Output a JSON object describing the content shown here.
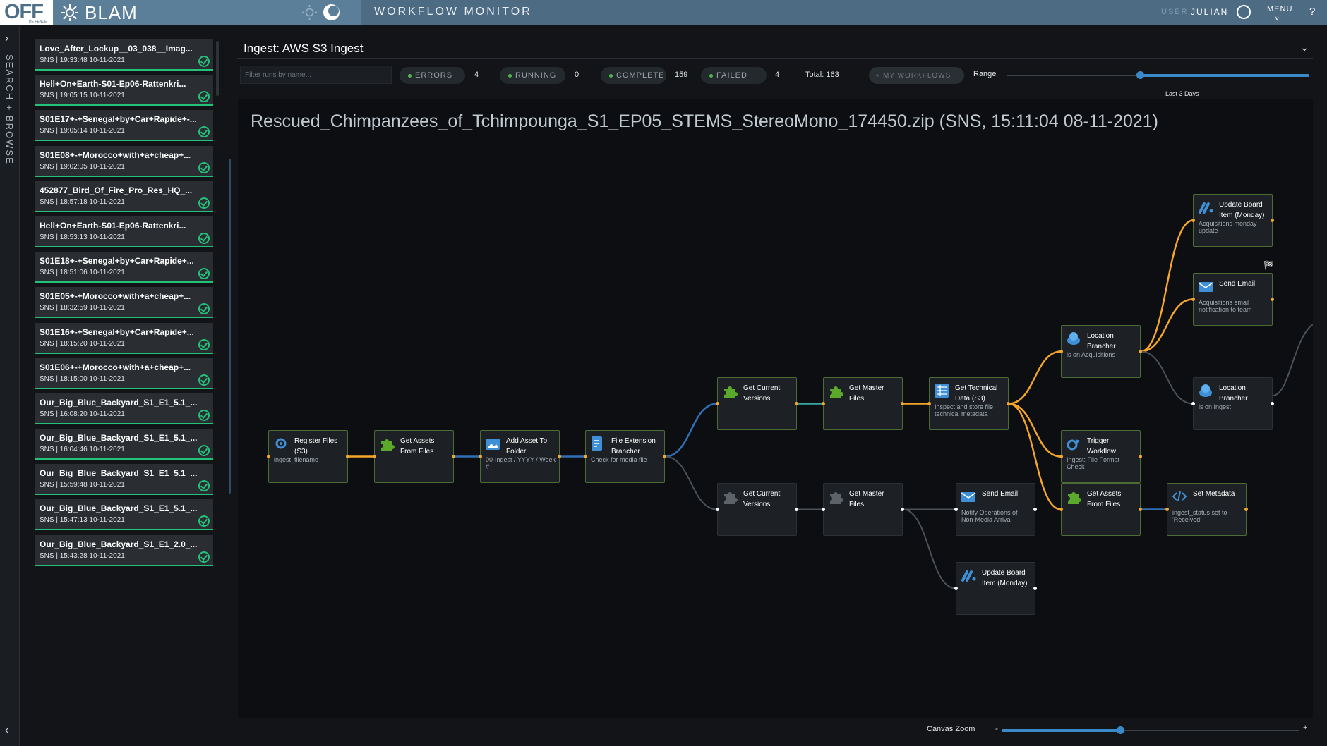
{
  "header": {
    "logo_text": "OFF",
    "logo_subtext": "THE FENCE",
    "brand": "BLAM",
    "app_title": "WORKFLOW MONITOR",
    "user_label": "USER",
    "user_name": "JULIAN",
    "menu_label": "MENU",
    "help_label": "?"
  },
  "sidebar": {
    "vertical_label": "SEARCH + BROWSE"
  },
  "runs": [
    {
      "name": "Love_After_Lockup__03_038__Imag...",
      "meta": "SNS | 19:33:48 10-11-2021",
      "status": "complete"
    },
    {
      "name": "Hell+On+Earth-S01-Ep06-Rattenkri...",
      "meta": "SNS | 19:05:15 10-11-2021",
      "status": "complete"
    },
    {
      "name": "S01E17+-+Senegal+by+Car+Rapide+-...",
      "meta": "SNS | 19:05:14 10-11-2021",
      "status": "complete"
    },
    {
      "name": "S01E08+-+Morocco+with+a+cheap+...",
      "meta": "SNS | 19:02:05 10-11-2021",
      "status": "complete"
    },
    {
      "name": "452877_Bird_Of_Fire_Pro_Res_HQ_...",
      "meta": "SNS | 18:57:18 10-11-2021",
      "status": "complete"
    },
    {
      "name": "Hell+On+Earth-S01-Ep06-Rattenkri...",
      "meta": "SNS | 18:53:13 10-11-2021",
      "status": "complete"
    },
    {
      "name": "S01E18+-+Senegal+by+Car+Rapide+...",
      "meta": "SNS | 18:51:06 10-11-2021",
      "status": "complete"
    },
    {
      "name": "S01E05+-+Morocco+with+a+cheap+...",
      "meta": "SNS | 18:32:59 10-11-2021",
      "status": "complete"
    },
    {
      "name": "S01E16+-+Senegal+by+Car+Rapide+...",
      "meta": "SNS | 18:15:20 10-11-2021",
      "status": "complete"
    },
    {
      "name": "S01E06+-+Morocco+with+a+cheap+...",
      "meta": "SNS | 18:15:00 10-11-2021",
      "status": "complete"
    },
    {
      "name": "Our_Big_Blue_Backyard_S1_E1_5.1_...",
      "meta": "SNS | 16:08:20 10-11-2021",
      "status": "complete"
    },
    {
      "name": "Our_Big_Blue_Backyard_S1_E1_5.1_...",
      "meta": "SNS | 16:04:46 10-11-2021",
      "status": "complete"
    },
    {
      "name": "Our_Big_Blue_Backyard_S1_E1_5.1_...",
      "meta": "SNS | 15:59:48 10-11-2021",
      "status": "complete"
    },
    {
      "name": "Our_Big_Blue_Backyard_S1_E1_5.1_...",
      "meta": "SNS | 15:47:13 10-11-2021",
      "status": "complete"
    },
    {
      "name": "Our_Big_Blue_Backyard_S1_E1_2.0_...",
      "meta": "SNS | 15:43:28 10-11-2021",
      "status": "complete"
    }
  ],
  "workflow_select": {
    "value": "Ingest: AWS S3 Ingest"
  },
  "filters": {
    "search_placeholder": "Filter runs by name...",
    "errors_label": "ERRORS",
    "errors_count": "4",
    "running_label": "RUNNING",
    "running_count": "0",
    "complete_label": "COMPLETE",
    "complete_count": "159",
    "failed_label": "FAILED",
    "failed_count": "4",
    "total_text": "Total:  163",
    "my_workflows_label": "MY WORKFLOWS",
    "range_label": "Range",
    "range_value": "Last 3 Days",
    "range_fraction": 0.44
  },
  "canvas": {
    "run_title": "Rescued_Chimpanzees_of_Tchimpounga_S1_EP05_STEMS_StereoMono_174450.zip (SNS, 15:11:04 08-11-2021)",
    "zoom_label": "Canvas Zoom",
    "zoom_fraction": 0.4
  },
  "nodes": [
    {
      "title": "Register Files (S3)",
      "desc": "ingest_filename",
      "icon": "register-icon",
      "status": "ok"
    },
    {
      "title": "Get Assets From Files",
      "desc": "",
      "icon": "puzzle-icon",
      "status": "ok"
    },
    {
      "title": "Add Asset To Folder",
      "desc": "00-Ingest / YYYY / Week #",
      "icon": "folder-icon",
      "status": "ok"
    },
    {
      "title": "File Extension Brancher",
      "desc": "Check for media file",
      "icon": "branch-icon",
      "status": "ok"
    },
    {
      "title": "Get Current Versions",
      "desc": "",
      "icon": "puzzle-icon",
      "status": "ok"
    },
    {
      "title": "Get Master Files",
      "desc": "",
      "icon": "puzzle-icon",
      "status": "ok"
    },
    {
      "title": "Get Technical Data (S3)",
      "desc": "Inspect and store file technical metadata",
      "icon": "data-icon",
      "status": "ok"
    },
    {
      "title": "Location Brancher",
      "desc": "is on Acquisitions",
      "icon": "location-icon",
      "status": "ok"
    },
    {
      "title": "Trigger Workflow",
      "desc": "Ingest: File Format Check",
      "icon": "trigger-icon",
      "status": "ok"
    },
    {
      "title": "Get Assets From Files",
      "desc": "",
      "icon": "puzzle-icon",
      "status": "ok"
    },
    {
      "title": "Set Metadata",
      "desc": "ingest_status set to 'Received'",
      "icon": "code-icon",
      "status": "ok"
    },
    {
      "title": "Update Board Item (Monday)",
      "desc": "Acquisitions monday update",
      "icon": "monday-icon",
      "status": "ok"
    },
    {
      "title": "Send Email",
      "desc": "Acquisitions email notification to team",
      "icon": "email-icon",
      "status": "ok"
    },
    {
      "title": "Location Brancher",
      "desc": "is on Ingest",
      "icon": "location-icon",
      "status": "skipped"
    },
    {
      "title": "Get Current Versions",
      "desc": "",
      "icon": "puzzle-icon",
      "status": "skipped"
    },
    {
      "title": "Get Master Files",
      "desc": "",
      "icon": "puzzle-icon",
      "status": "skipped"
    },
    {
      "title": "Send Email",
      "desc": "Notify Operations of Non-Media Arrival",
      "icon": "email-icon",
      "status": "skipped"
    },
    {
      "title": "Update Board Item (Monday)",
      "desc": "",
      "icon": "monday-icon",
      "status": "skipped"
    }
  ],
  "colors": {
    "topbar": "#5c7f99",
    "accent_blue": "#3a89c9",
    "success_green": "#22c27a",
    "edge_orange": "#f4a62a",
    "edge_blue": "#2f6fb5",
    "edge_gray": "#4a5258",
    "node_ok_border": "#4c6b35"
  }
}
